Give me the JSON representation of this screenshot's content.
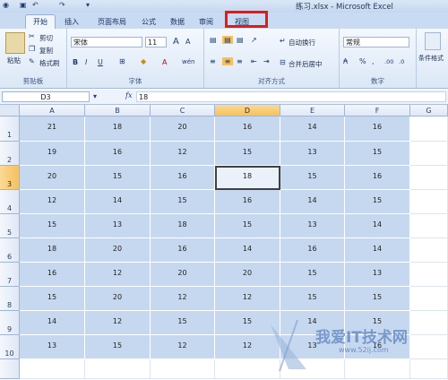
{
  "title": "练习.xlsx - Microsoft Excel",
  "tabs": [
    {
      "label": "开始",
      "active": true
    },
    {
      "label": "插入"
    },
    {
      "label": "页面布局"
    },
    {
      "label": "公式"
    },
    {
      "label": "数据"
    },
    {
      "label": "审阅"
    },
    {
      "label": "视图"
    }
  ],
  "clipboard": {
    "paste": "粘贴",
    "cut": "剪切",
    "copy": "复制",
    "format_painter": "格式刷",
    "label": "剪贴板"
  },
  "font": {
    "name": "宋体",
    "size": "11",
    "grow": "A",
    "shrink": "A",
    "bold": "B",
    "italic": "I",
    "underline": "U",
    "font_color": "A",
    "phonetic": "wén",
    "label": "字体"
  },
  "alignment": {
    "wrap_text": "自动换行",
    "merge_center": "合并后居中",
    "label": "对齐方式"
  },
  "number": {
    "format": "常规",
    "percent": "%",
    "comma": ",",
    "label": "数字"
  },
  "styles": {
    "conditional": "条件格式"
  },
  "formula_bar": {
    "name_box": "D3",
    "fx": "fx",
    "value": "18"
  },
  "columns": [
    "A",
    "B",
    "C",
    "D",
    "E",
    "F",
    "G"
  ],
  "rows": [
    "1",
    "2",
    "3",
    "4",
    "5",
    "6",
    "7",
    "8",
    "9",
    "10"
  ],
  "cells": [
    [
      "21",
      "18",
      "20",
      "16",
      "14",
      "16"
    ],
    [
      "19",
      "16",
      "12",
      "15",
      "13",
      "15"
    ],
    [
      "20",
      "15",
      "16",
      "18",
      "15",
      "16"
    ],
    [
      "12",
      "14",
      "15",
      "16",
      "14",
      "15"
    ],
    [
      "15",
      "13",
      "18",
      "15",
      "13",
      "14"
    ],
    [
      "18",
      "20",
      "16",
      "14",
      "16",
      "14"
    ],
    [
      "16",
      "12",
      "20",
      "20",
      "15",
      "13"
    ],
    [
      "15",
      "20",
      "12",
      "12",
      "15",
      "15"
    ],
    [
      "14",
      "12",
      "15",
      "15",
      "14",
      "15"
    ],
    [
      "13",
      "15",
      "12",
      "12",
      "13",
      "16"
    ]
  ],
  "selected_cell": "D3",
  "watermark": {
    "text": "我爱IT技术网",
    "url": "www.52ij.com"
  },
  "colors": {
    "selection": "#c6d8ef",
    "highlight": "#e01b1b"
  }
}
